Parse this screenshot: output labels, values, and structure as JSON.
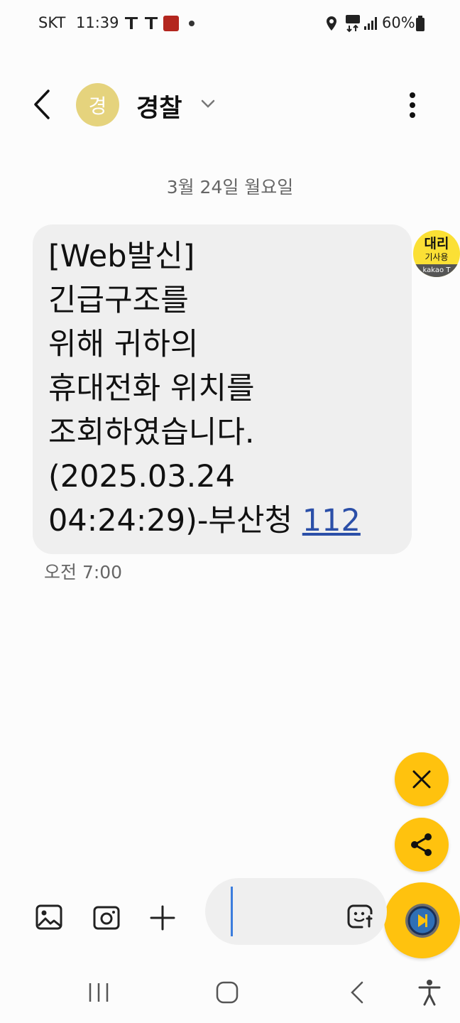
{
  "status_bar": {
    "carrier": "SKT",
    "time": "11:39",
    "battery": "60%"
  },
  "header": {
    "avatar_initial": "경",
    "contact_name": "경찰"
  },
  "date_separator": "3월 24일 월요일",
  "message": {
    "text": "[Web발신]\n긴급구조를\n위해 귀하의\n휴대전화 위치를\n조회하였습니다.\n(2025.03.24\n04:24:29)-부산청 ",
    "link": "112",
    "time": "오전 7:00"
  },
  "kakao_badge": {
    "line1": "대리",
    "line2": "기사용",
    "brand": "kakao T"
  },
  "colors": {
    "accent": "#ffc20e",
    "avatar": "#e5d37d",
    "link": "#2b4fa8",
    "bubble": "#efefef"
  },
  "icons": {
    "composer": [
      "gallery-icon",
      "camera-icon",
      "plus-icon",
      "sticker-icon"
    ],
    "fabs": [
      "close-icon",
      "share-icon",
      "record-icon"
    ],
    "nav": [
      "recent-apps-icon",
      "home-icon",
      "back-icon",
      "accessibility-icon"
    ]
  }
}
